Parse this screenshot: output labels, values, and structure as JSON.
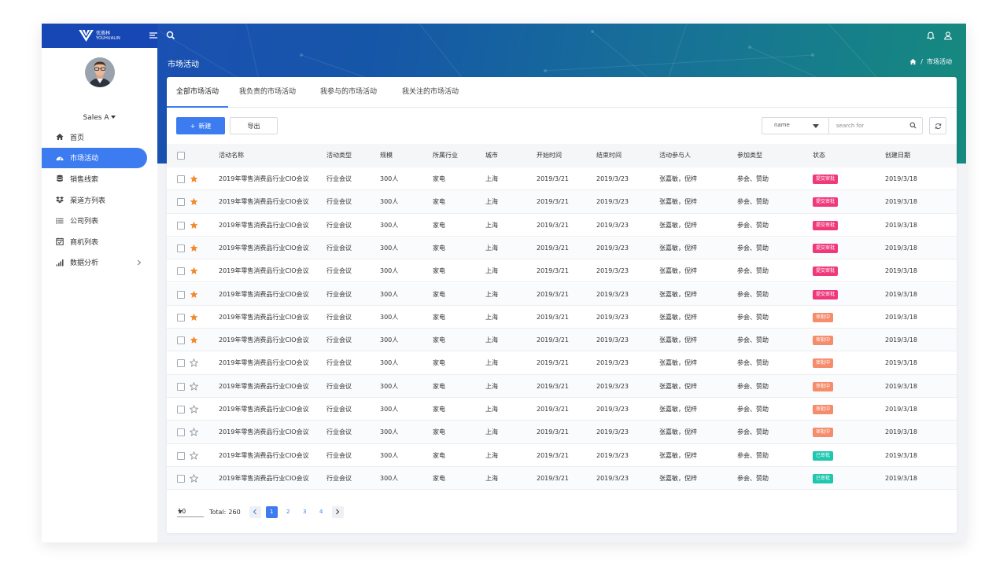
{
  "brand": {
    "name_cn": "优荟林",
    "name_en": "YOUHUALIN"
  },
  "header": {
    "page_title": "市场活动",
    "breadcrumb_current": "市场活动"
  },
  "user": {
    "name": "Sales A"
  },
  "sidebar": {
    "items": [
      {
        "label": "首页",
        "icon": "home-icon",
        "active": false
      },
      {
        "label": "市场活动",
        "icon": "dashboard-icon",
        "active": true
      },
      {
        "label": "销售线索",
        "icon": "database-icon",
        "active": false
      },
      {
        "label": "渠道方列表",
        "icon": "dropbox-icon",
        "active": false
      },
      {
        "label": "公司列表",
        "icon": "list-icon",
        "active": false
      },
      {
        "label": "商机列表",
        "icon": "calendar-check-icon",
        "active": false
      },
      {
        "label": "数据分析",
        "icon": "bar-chart-icon",
        "active": false,
        "has_children": true
      }
    ]
  },
  "tabs": [
    {
      "label": "全部市场活动",
      "active": true
    },
    {
      "label": "我负责的市场活动",
      "active": false
    },
    {
      "label": "我参与的市场活动",
      "active": false
    },
    {
      "label": "我关注的市场活动",
      "active": false
    }
  ],
  "toolbar": {
    "new_label": "新建",
    "export_label": "导出"
  },
  "filter": {
    "field_value": "name",
    "search_placeholder": "search for"
  },
  "table": {
    "columns": [
      "活动名称",
      "活动类型",
      "规模",
      "所属行业",
      "城市",
      "开始时间",
      "结束时间",
      "活动参与人",
      "参加类型",
      "状态",
      "创建日期"
    ],
    "rows": [
      {
        "starred": true,
        "name": "2019年零售消费品行业CIO会议",
        "type": "行业会议",
        "scale": "300人",
        "industry": "家电",
        "city": "上海",
        "start": "2019/3/21",
        "end": "2019/3/23",
        "participants": "张嘉敏，倪梓",
        "join_type": "参会、赞助",
        "status": "提交审批",
        "status_kind": "submitted",
        "created": "2019/3/18"
      },
      {
        "starred": true,
        "name": "2019年零售消费品行业CIO会议",
        "type": "行业会议",
        "scale": "300人",
        "industry": "家电",
        "city": "上海",
        "start": "2019/3/21",
        "end": "2019/3/23",
        "participants": "张嘉敏，倪梓",
        "join_type": "参会、赞助",
        "status": "提交审批",
        "status_kind": "submitted",
        "created": "2019/3/18"
      },
      {
        "starred": true,
        "name": "2019年零售消费品行业CIO会议",
        "type": "行业会议",
        "scale": "300人",
        "industry": "家电",
        "city": "上海",
        "start": "2019/3/21",
        "end": "2019/3/23",
        "participants": "张嘉敏，倪梓",
        "join_type": "参会、赞助",
        "status": "提交审批",
        "status_kind": "submitted",
        "created": "2019/3/18"
      },
      {
        "starred": true,
        "name": "2019年零售消费品行业CIO会议",
        "type": "行业会议",
        "scale": "300人",
        "industry": "家电",
        "city": "上海",
        "start": "2019/3/21",
        "end": "2019/3/23",
        "participants": "张嘉敏，倪梓",
        "join_type": "参会、赞助",
        "status": "提交审批",
        "status_kind": "submitted",
        "created": "2019/3/18"
      },
      {
        "starred": true,
        "name": "2019年零售消费品行业CIO会议",
        "type": "行业会议",
        "scale": "300人",
        "industry": "家电",
        "city": "上海",
        "start": "2019/3/21",
        "end": "2019/3/23",
        "participants": "张嘉敏，倪梓",
        "join_type": "参会、赞助",
        "status": "提交审批",
        "status_kind": "submitted",
        "created": "2019/3/18"
      },
      {
        "starred": true,
        "name": "2019年零售消费品行业CIO会议",
        "type": "行业会议",
        "scale": "300人",
        "industry": "家电",
        "city": "上海",
        "start": "2019/3/21",
        "end": "2019/3/23",
        "participants": "张嘉敏，倪梓",
        "join_type": "参会、赞助",
        "status": "提交审批",
        "status_kind": "submitted",
        "created": "2019/3/18"
      },
      {
        "starred": true,
        "name": "2019年零售消费品行业CIO会议",
        "type": "行业会议",
        "scale": "300人",
        "industry": "家电",
        "city": "上海",
        "start": "2019/3/21",
        "end": "2019/3/23",
        "participants": "张嘉敏，倪梓",
        "join_type": "参会、赞助",
        "status": "审批中",
        "status_kind": "pending",
        "created": "2019/3/18"
      },
      {
        "starred": true,
        "name": "2019年零售消费品行业CIO会议",
        "type": "行业会议",
        "scale": "300人",
        "industry": "家电",
        "city": "上海",
        "start": "2019/3/21",
        "end": "2019/3/23",
        "participants": "张嘉敏，倪梓",
        "join_type": "参会、赞助",
        "status": "审批中",
        "status_kind": "pending",
        "created": "2019/3/18"
      },
      {
        "starred": false,
        "name": "2019年零售消费品行业CIO会议",
        "type": "行业会议",
        "scale": "300人",
        "industry": "家电",
        "city": "上海",
        "start": "2019/3/21",
        "end": "2019/3/23",
        "participants": "张嘉敏，倪梓",
        "join_type": "参会、赞助",
        "status": "审批中",
        "status_kind": "pending",
        "created": "2019/3/18"
      },
      {
        "starred": false,
        "name": "2019年零售消费品行业CIO会议",
        "type": "行业会议",
        "scale": "300人",
        "industry": "家电",
        "city": "上海",
        "start": "2019/3/21",
        "end": "2019/3/23",
        "participants": "张嘉敏，倪梓",
        "join_type": "参会、赞助",
        "status": "审批中",
        "status_kind": "pending",
        "created": "2019/3/18"
      },
      {
        "starred": false,
        "name": "2019年零售消费品行业CIO会议",
        "type": "行业会议",
        "scale": "300人",
        "industry": "家电",
        "city": "上海",
        "start": "2019/3/21",
        "end": "2019/3/23",
        "participants": "张嘉敏，倪梓",
        "join_type": "参会、赞助",
        "status": "审批中",
        "status_kind": "pending",
        "created": "2019/3/18"
      },
      {
        "starred": false,
        "name": "2019年零售消费品行业CIO会议",
        "type": "行业会议",
        "scale": "300人",
        "industry": "家电",
        "city": "上海",
        "start": "2019/3/21",
        "end": "2019/3/23",
        "participants": "张嘉敏，倪梓",
        "join_type": "参会、赞助",
        "status": "审批中",
        "status_kind": "pending",
        "created": "2019/3/18"
      },
      {
        "starred": false,
        "name": "2019年零售消费品行业CIO会议",
        "type": "行业会议",
        "scale": "300人",
        "industry": "家电",
        "city": "上海",
        "start": "2019/3/21",
        "end": "2019/3/23",
        "participants": "张嘉敏，倪梓",
        "join_type": "参会、赞助",
        "status": "已审批",
        "status_kind": "approved",
        "created": "2019/3/18"
      },
      {
        "starred": false,
        "name": "2019年零售消费品行业CIO会议",
        "type": "行业会议",
        "scale": "300人",
        "industry": "家电",
        "city": "上海",
        "start": "2019/3/21",
        "end": "2019/3/23",
        "participants": "张嘉敏，倪梓",
        "join_type": "参会、赞助",
        "status": "已审批",
        "status_kind": "approved",
        "created": "2019/3/18"
      }
    ]
  },
  "pagination": {
    "page_size": "10",
    "total_label": "Total:",
    "total": "260",
    "pages": [
      "1",
      "2",
      "3",
      "4"
    ],
    "current": "1"
  },
  "colors": {
    "accent": "#3d7bf0",
    "star": "#f08a2c",
    "submitted": "#f0397a",
    "pending": "#f58c6b",
    "approved": "#1ec7ad"
  }
}
